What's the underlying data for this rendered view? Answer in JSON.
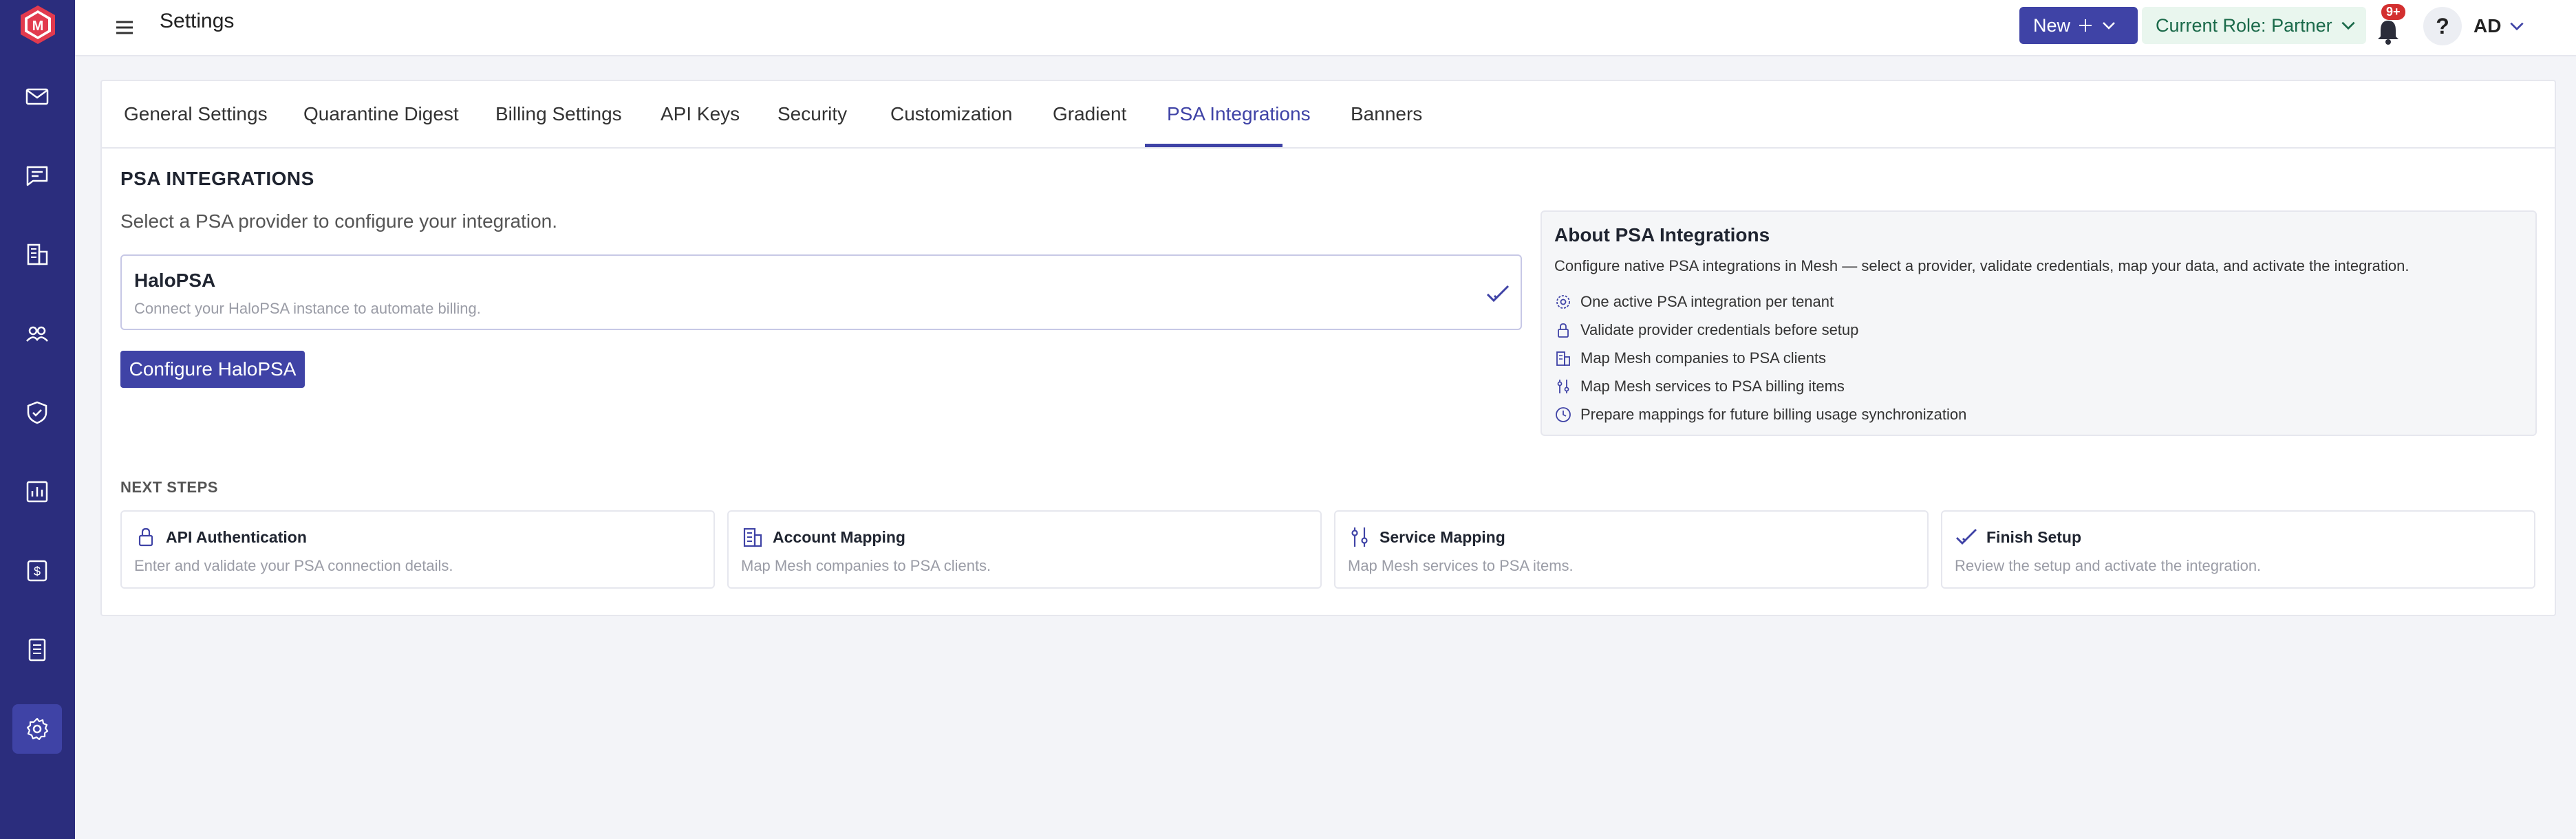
{
  "app": {
    "page_title": "Settings"
  },
  "topbar": {
    "new_label": "New",
    "role_label": "Current Role: Partner",
    "notification_badge": "9+",
    "help_label": "?",
    "user_initials": "AD"
  },
  "tabs": [
    {
      "label": "General Settings"
    },
    {
      "label": "Quarantine Digest"
    },
    {
      "label": "Billing Settings"
    },
    {
      "label": "API Keys"
    },
    {
      "label": "Security"
    },
    {
      "label": "Customization"
    },
    {
      "label": "Gradient"
    },
    {
      "label": "PSA Integrations",
      "active": true
    },
    {
      "label": "Banners"
    }
  ],
  "psa": {
    "section_title": "PSA INTEGRATIONS",
    "subtitle": "Select a PSA provider to configure your integration.",
    "provider": {
      "name": "HaloPSA",
      "description": "Connect your HaloPSA instance to automate billing."
    },
    "configure_button": "Configure HaloPSA"
  },
  "about": {
    "title": "About PSA Integrations",
    "description": "Configure native PSA integrations in Mesh — select a provider, validate credentials, map your data, and activate the integration.",
    "items": [
      {
        "icon": "gear-icon",
        "text": "One active PSA integration per tenant"
      },
      {
        "icon": "lock-icon",
        "text": "Validate provider credentials before setup"
      },
      {
        "icon": "building-icon",
        "text": "Map Mesh companies to PSA clients"
      },
      {
        "icon": "sliders-icon",
        "text": "Map Mesh services to PSA billing items"
      },
      {
        "icon": "clock-icon",
        "text": "Prepare mappings for future billing usage synchronization"
      }
    ]
  },
  "next_steps": {
    "label": "NEXT STEPS",
    "steps": [
      {
        "icon": "lock-icon",
        "title": "API Authentication",
        "description": "Enter and validate your PSA connection details."
      },
      {
        "icon": "building-icon",
        "title": "Account Mapping",
        "description": "Map Mesh companies to PSA clients."
      },
      {
        "icon": "sliders-icon",
        "title": "Service Mapping",
        "description": "Map Mesh services to PSA items."
      },
      {
        "icon": "check-icon",
        "title": "Finish Setup",
        "description": "Review the setup and activate the integration."
      }
    ]
  },
  "colors": {
    "sidebar_bg": "#2b2d7d",
    "accent": "#3f43a6",
    "role_bg": "#e9f6ee",
    "badge": "#d32f2f"
  }
}
